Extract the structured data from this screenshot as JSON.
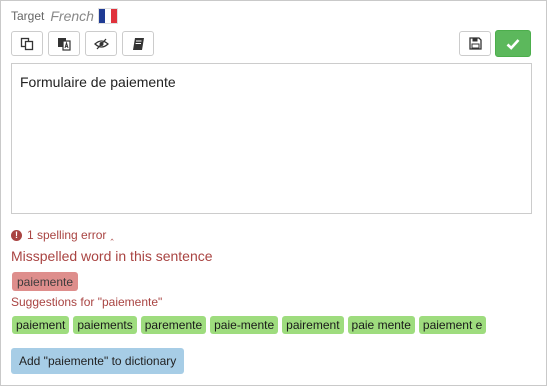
{
  "target": {
    "label": "Target",
    "language": "French",
    "flag_icon": "france-flag-icon"
  },
  "toolbar": {
    "buttons": [
      {
        "icon": "copy-source-icon"
      },
      {
        "icon": "translate-icon"
      },
      {
        "icon": "hide-eye-icon"
      },
      {
        "icon": "glossary-book-icon"
      }
    ],
    "save_icon": "floppy-disk-icon",
    "confirm_icon": "checkmark-icon",
    "confirm_color": "#5cb85c"
  },
  "editor": {
    "text": "Formulaire de paiemente"
  },
  "spelling": {
    "toggle_label": "1 spelling error",
    "toggle_icon": "exclamation-circle-icon",
    "caret_icon": "chevron-up-icon",
    "misspelled_title": "Misspelled word in this sentence",
    "misspelled_word": "paiemente",
    "suggestions_title": "Suggestions for \"paiemente\"",
    "suggestions": [
      "paiement",
      "paiements",
      "paremente",
      "paie-mente",
      "pairement",
      "paie mente",
      "paiement e"
    ],
    "add_to_dictionary": "Add \"paiemente\" to dictionary",
    "error_color": "#a94442",
    "suggestion_color": "#9edc7e",
    "dictionary_color": "#a7cde6"
  }
}
